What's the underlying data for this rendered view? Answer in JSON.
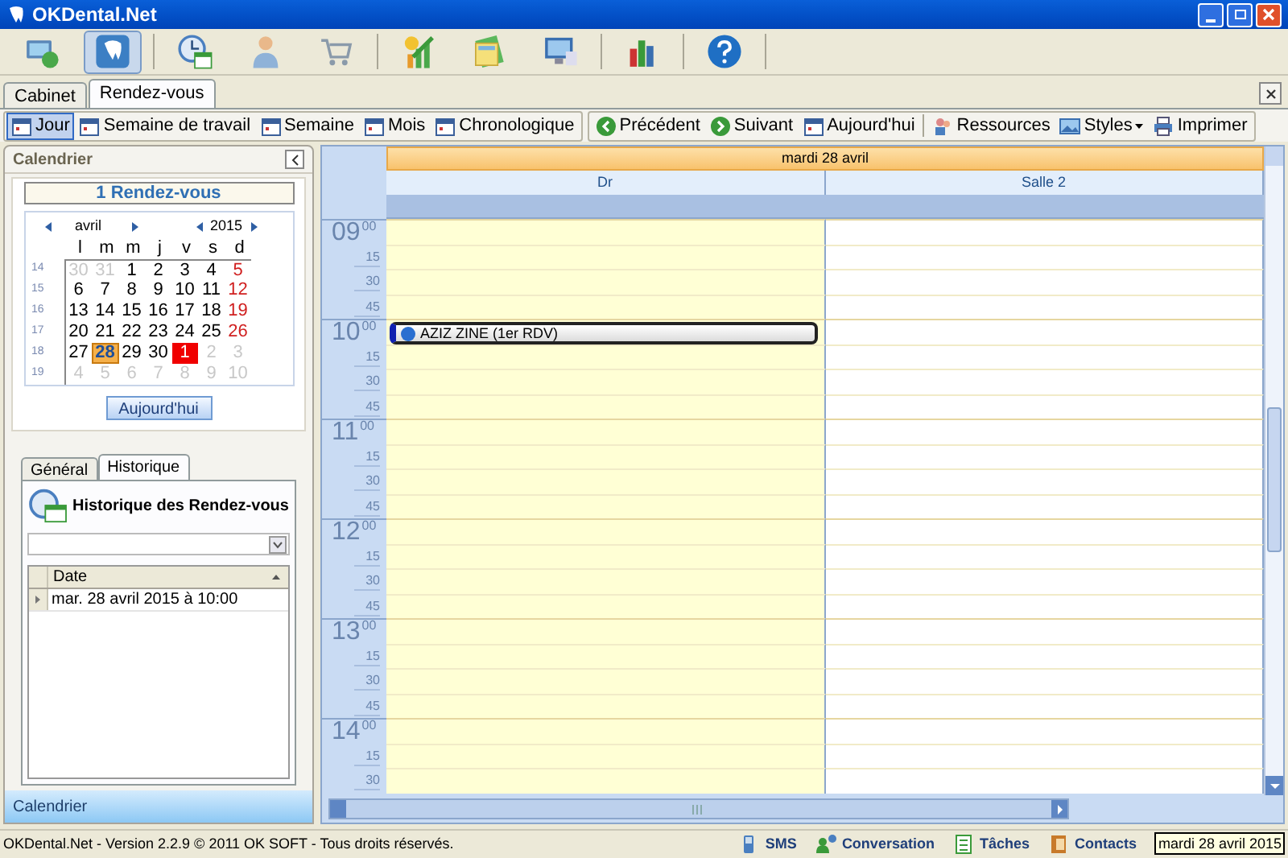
{
  "window": {
    "title": "OKDental.Net"
  },
  "toolbar": [
    {
      "selected": false
    },
    {
      "selected": true
    },
    {
      "selected": false
    },
    {
      "selected": false
    },
    {
      "selected": false
    },
    {
      "selected": false
    },
    {
      "selected": false
    },
    {
      "selected": false
    },
    {
      "selected": false
    },
    {
      "selected": false
    }
  ],
  "tabs": [
    {
      "label": "Cabinet",
      "selected": false
    },
    {
      "label": "Rendez-vous",
      "selected": true
    }
  ],
  "view_toolbar": [
    {
      "label": "Jour",
      "selected": true
    },
    {
      "label": "Semaine de travail",
      "selected": false
    },
    {
      "label": "Semaine",
      "selected": false
    },
    {
      "label": "Mois",
      "selected": false
    },
    {
      "label": "Chronologique",
      "selected": false
    }
  ],
  "nav_toolbar": [
    {
      "label": "Précédent",
      "kind": "prev"
    },
    {
      "label": "Suivant",
      "kind": "next"
    },
    {
      "label": "Aujourd'hui",
      "kind": "today"
    },
    {
      "label": "Ressources",
      "kind": "resources"
    },
    {
      "label": "Styles",
      "kind": "styles"
    },
    {
      "label": "Imprimer",
      "kind": "print"
    }
  ],
  "sidebar": {
    "title": "Calendrier",
    "appointment_count": "1 Rendez-vous",
    "calendar": {
      "month": "avril",
      "year": "2015",
      "weekdays": [
        "l",
        "m",
        "m",
        "j",
        "v",
        "s",
        "d"
      ],
      "weeks": [
        {
          "number": "14",
          "days": [
            {
              "label": "30",
              "other_month": true,
              "selected": false,
              "today": false
            },
            {
              "label": "31",
              "other_month": true,
              "selected": false,
              "today": false
            },
            {
              "label": "1",
              "other_month": false,
              "selected": false,
              "today": false
            },
            {
              "label": "2",
              "other_month": false,
              "selected": false,
              "today": false
            },
            {
              "label": "3",
              "other_month": false,
              "selected": false,
              "today": false
            },
            {
              "label": "4",
              "other_month": false,
              "selected": false,
              "today": false
            },
            {
              "label": "5",
              "other_month": false,
              "selected": false,
              "today": false
            }
          ]
        },
        {
          "number": "15",
          "days": [
            {
              "label": "6",
              "other_month": false,
              "selected": false,
              "today": false
            },
            {
              "label": "7",
              "other_month": false,
              "selected": false,
              "today": false
            },
            {
              "label": "8",
              "other_month": false,
              "selected": false,
              "today": false
            },
            {
              "label": "9",
              "other_month": false,
              "selected": false,
              "today": false
            },
            {
              "label": "10",
              "other_month": false,
              "selected": false,
              "today": false
            },
            {
              "label": "11",
              "other_month": false,
              "selected": false,
              "today": false
            },
            {
              "label": "12",
              "other_month": false,
              "selected": false,
              "today": false
            }
          ]
        },
        {
          "number": "16",
          "days": [
            {
              "label": "13",
              "other_month": false,
              "selected": false,
              "today": false
            },
            {
              "label": "14",
              "other_month": false,
              "selected": false,
              "today": false
            },
            {
              "label": "15",
              "other_month": false,
              "selected": false,
              "today": false
            },
            {
              "label": "16",
              "other_month": false,
              "selected": false,
              "today": false
            },
            {
              "label": "17",
              "other_month": false,
              "selected": false,
              "today": false
            },
            {
              "label": "18",
              "other_month": false,
              "selected": false,
              "today": false
            },
            {
              "label": "19",
              "other_month": false,
              "selected": false,
              "today": false
            }
          ]
        },
        {
          "number": "17",
          "days": [
            {
              "label": "20",
              "other_month": false,
              "selected": false,
              "today": false
            },
            {
              "label": "21",
              "other_month": false,
              "selected": false,
              "today": false
            },
            {
              "label": "22",
              "other_month": false,
              "selected": false,
              "today": false
            },
            {
              "label": "23",
              "other_month": false,
              "selected": false,
              "today": false
            },
            {
              "label": "24",
              "other_month": false,
              "selected": false,
              "today": false
            },
            {
              "label": "25",
              "other_month": false,
              "selected": false,
              "today": false
            },
            {
              "label": "26",
              "other_month": false,
              "selected": false,
              "today": false
            }
          ]
        },
        {
          "number": "18",
          "days": [
            {
              "label": "27",
              "other_month": false,
              "selected": false,
              "today": false
            },
            {
              "label": "28",
              "other_month": false,
              "selected": true,
              "today": false
            },
            {
              "label": "29",
              "other_month": false,
              "selected": false,
              "today": false
            },
            {
              "label": "30",
              "other_month": false,
              "selected": false,
              "today": false
            },
            {
              "label": "1",
              "other_month": true,
              "selected": false,
              "today": true
            },
            {
              "label": "2",
              "other_month": true,
              "selected": false,
              "today": false
            },
            {
              "label": "3",
              "other_month": true,
              "selected": false,
              "today": false
            }
          ]
        },
        {
          "number": "19",
          "days": [
            {
              "label": "4",
              "other_month": true,
              "selected": false,
              "today": false
            },
            {
              "label": "5",
              "other_month": true,
              "selected": false,
              "today": false
            },
            {
              "label": "6",
              "other_month": true,
              "selected": false,
              "today": false
            },
            {
              "label": "7",
              "other_month": true,
              "selected": false,
              "today": false
            },
            {
              "label": "8",
              "other_month": true,
              "selected": false,
              "today": false
            },
            {
              "label": "9",
              "other_month": true,
              "selected": false,
              "today": false
            },
            {
              "label": "10",
              "other_month": true,
              "selected": false,
              "today": false
            }
          ]
        }
      ]
    },
    "today_button": "Aujourd'hui",
    "tabs": [
      {
        "label": "Général",
        "selected": false
      },
      {
        "label": "Historique",
        "selected": true
      }
    ],
    "history": {
      "title": "Historique des Rendez-vous",
      "columns": [
        "Date"
      ],
      "rows": [
        "mar. 28 avril 2015 à 10:00"
      ]
    },
    "footer": "Calendrier"
  },
  "scheduler": {
    "date": "mardi 28 avril",
    "resources": [
      {
        "name": "Dr",
        "color": "#ffffd5"
      },
      {
        "name": "Salle 2",
        "color": "#ffffff"
      }
    ],
    "time_rows": [
      {
        "hour": "09",
        "minute": "00"
      },
      {
        "minute": "15"
      },
      {
        "minute": "30"
      },
      {
        "minute": "45"
      },
      {
        "hour": "10",
        "minute": "00",
        "appointment": "AZIZ ZINE (1er RDV)"
      },
      {
        "minute": "15"
      },
      {
        "minute": "30"
      },
      {
        "minute": "45"
      },
      {
        "hour": "11",
        "minute": "00"
      },
      {
        "minute": "15"
      },
      {
        "minute": "30"
      },
      {
        "minute": "45"
      },
      {
        "hour": "12",
        "minute": "00"
      },
      {
        "minute": "15"
      },
      {
        "minute": "30"
      },
      {
        "minute": "45"
      },
      {
        "hour": "13",
        "minute": "00"
      },
      {
        "minute": "15"
      },
      {
        "minute": "30"
      },
      {
        "minute": "45"
      },
      {
        "hour": "14",
        "minute": "00"
      },
      {
        "minute": "15"
      },
      {
        "minute": "30"
      }
    ]
  },
  "status_bar": {
    "text": "OKDental.Net - Version 2.2.9 © 2011 OK SOFT - Tous droits réservés.",
    "links": [
      {
        "label": "SMS",
        "kind": "sms"
      },
      {
        "label": "Conversation",
        "kind": "chat"
      },
      {
        "label": "Tâches",
        "kind": "tasks"
      },
      {
        "label": "Contacts",
        "kind": "contacts"
      }
    ],
    "tooltip": "mardi 28 avril 2015"
  }
}
